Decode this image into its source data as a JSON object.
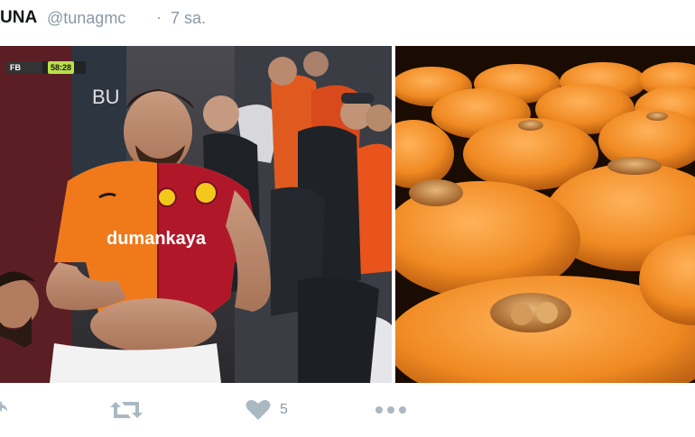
{
  "tweet": {
    "display_name": "UNA",
    "handle": "@tunagmc",
    "separator": "·",
    "time": "7 sa."
  },
  "media": {
    "left_photo": {
      "scoreboard_team": "FB",
      "scoreboard_time": "58:28",
      "sponsor_text": "dumankaya",
      "bg_text": "BU"
    },
    "right_photo": {}
  },
  "actions": {
    "reply_icon": "reply-icon",
    "retweet_icon": "retweet-icon",
    "like_icon": "heart-icon",
    "like_count": "5",
    "more_icon": "more-icon"
  },
  "colors": {
    "muted_text": "#8899a6",
    "icon_gray": "#aab8c2",
    "jersey_orange": "#f07a1a",
    "jersey_red": "#b0182a"
  }
}
